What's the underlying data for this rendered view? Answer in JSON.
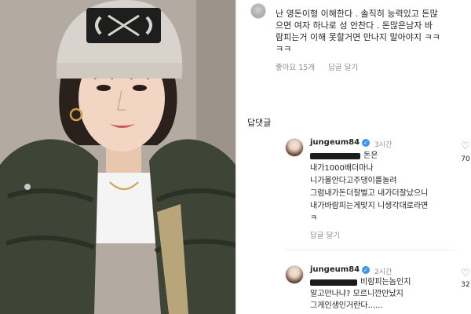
{
  "top_comment": {
    "lines": [
      "난 영돈이형 이해한다 . 솔직히 능력있고 돈많",
      "으면 여자 하나로 성 안찬다 .  돈많은남자 바",
      "람피는거 이해 못할거면 만나지 말아야지 ㅋㅋ",
      "ㅋㅋ"
    ],
    "likes": "좋아요 15개",
    "reply_label": "답글 달기"
  },
  "replies_header": "답댓글",
  "replies": [
    {
      "username": "jungeum84",
      "time": "3시간",
      "first_line_suffix": "돈은",
      "lines": [
        "내가1000배더마나",
        "니가몰안다고주댕이를놀려",
        "그럼내가돈더잘벌고 내가더잘났으니",
        "내가바람피는게맞지 니생각대로라면",
        "ㅋ"
      ],
      "reply_label": "답글 달기",
      "like_count": "70"
    },
    {
      "username": "jungeum84",
      "time": "2시간",
      "first_line_suffix": "비람피는놈인지",
      "lines": [
        "알고만나냐? 모르니깐만났지",
        "그게인생인거란다......"
      ],
      "like_count": "32"
    }
  ],
  "colors": {
    "meta_gray": "#8e8e8e",
    "text": "#262626",
    "verified_blue": "#3897f0",
    "redaction": "#1c1c1c"
  },
  "icons": [
    "heart-icon",
    "verified-badge-icon"
  ]
}
